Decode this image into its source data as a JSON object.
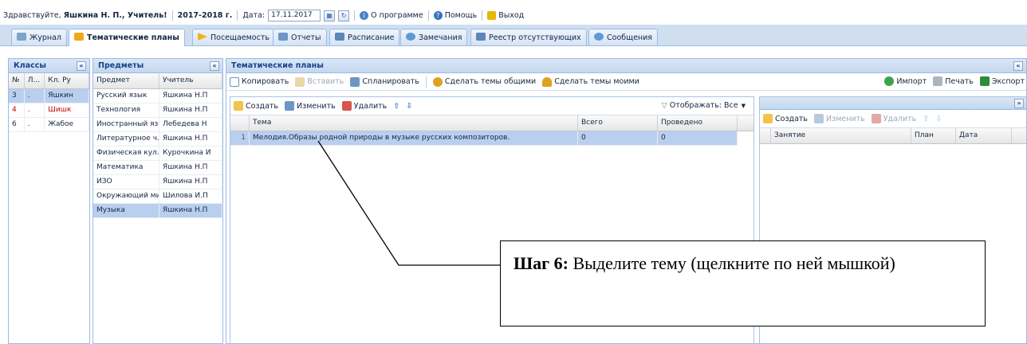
{
  "topbar": {
    "greeting": "Здравствуйте,",
    "user": "Яшкина Н. П., Учитель!",
    "year": "2017-2018 г.",
    "date_label": "Дата:",
    "date_value": "17.11.2017",
    "about": "О программе",
    "help": "Помощь",
    "exit": "Выход"
  },
  "tabs": [
    {
      "label": "Журнал"
    },
    {
      "label": "Тематические планы"
    },
    {
      "label": "Посещаемость"
    },
    {
      "label": "Отчеты"
    },
    {
      "label": "Расписание"
    },
    {
      "label": "Замечания"
    },
    {
      "label": "Реестр отсутствующих"
    },
    {
      "label": "Сообщения"
    }
  ],
  "classes": {
    "title": "Классы",
    "columns": [
      "№",
      "Л...",
      "Кл. Ру"
    ],
    "rows": [
      {
        "num": "3",
        "l": ".",
        "teacher": "Яшкин"
      },
      {
        "num": "4",
        "l": ".",
        "teacher": "Шишк"
      },
      {
        "num": "6",
        "l": ".",
        "teacher": "Жабое"
      }
    ]
  },
  "subjects": {
    "title": "Предметы",
    "columns": [
      "Предмет",
      "Учитель"
    ],
    "rows": [
      {
        "subject": "Русский язык",
        "teacher": "Яшкина Н.П"
      },
      {
        "subject": "Технология",
        "teacher": "Яшкина Н.П"
      },
      {
        "subject": "Иностранный яз...",
        "teacher": "Лебедева Н"
      },
      {
        "subject": "Литературное ч...",
        "teacher": "Яшкина Н.П"
      },
      {
        "subject": "Физическая кул...",
        "teacher": "Курочкина И"
      },
      {
        "subject": "Математика",
        "teacher": "Яшкина Н.П"
      },
      {
        "subject": "ИЗО",
        "teacher": "Яшкина Н.П"
      },
      {
        "subject": "Окружающий мир",
        "teacher": "Шилова И.П"
      },
      {
        "subject": "Музыка",
        "teacher": "Яшкина Н.П"
      }
    ]
  },
  "plans": {
    "title": "Тематические планы",
    "toolbar": {
      "copy": "Копировать",
      "paste": "Вставить",
      "plan": "Спланировать",
      "make_common": "Сделать темы общими",
      "make_mine": "Сделать темы моими",
      "import": "Импорт",
      "print": "Печать",
      "export": "Экспорт"
    },
    "subtoolbar": {
      "create": "Создать",
      "edit": "Изменить",
      "delete": "Удалить",
      "filter": "Отображать: Все"
    },
    "columns": [
      "Тема",
      "Всего",
      "Проведено"
    ],
    "rows": [
      {
        "n": "1",
        "topic": "Мелодия.Образы родной природы в музыке русских композиторов.",
        "total": "0",
        "done": "0"
      }
    ]
  },
  "lessons": {
    "toolbar": {
      "create": "Создать",
      "edit": "Изменить",
      "delete": "Удалить"
    },
    "columns": [
      "Занятие",
      "План",
      "Дата"
    ]
  },
  "callout": {
    "step": "Шаг 6:",
    "text": " Выделите тему (щелкните по ней мышкой)"
  }
}
